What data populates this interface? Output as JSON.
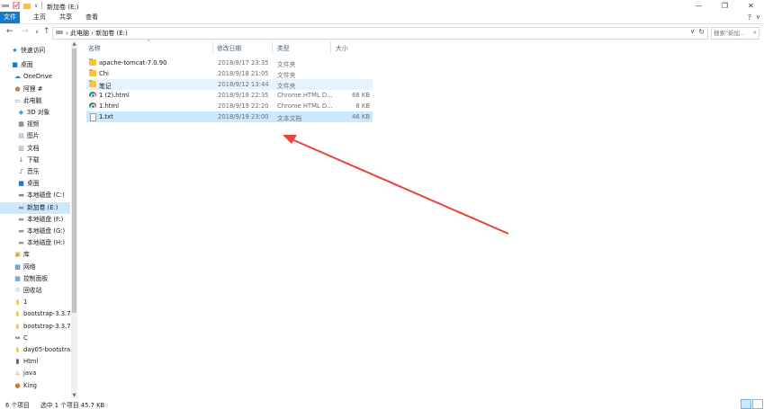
{
  "window": {
    "title": "新加卷 (E:)",
    "controls": [
      "—",
      "❐",
      "✕"
    ]
  },
  "ribbon": {
    "tabs": [
      "文件",
      "主页",
      "共享",
      "查看"
    ],
    "help": "?",
    "expand": "∨"
  },
  "nav": {
    "back": "←",
    "forward": "→",
    "recent": "∨",
    "up": "↑"
  },
  "address": {
    "crumbs": "›  此电脑  ›  新加卷 (E:)",
    "dropdown": "∨",
    "refresh": "↻"
  },
  "search": {
    "placeholder": "搜索\"新加...",
    "icon": "⌕"
  },
  "sidebar": {
    "items": [
      {
        "label": "快速访问",
        "icon": "★",
        "color": "#2a7ad5"
      },
      {
        "label": "桌面",
        "icon": "■",
        "color": "#1979ca"
      },
      {
        "label": "OneDrive",
        "icon": "☁",
        "color": "#2a7ad5"
      },
      {
        "label": "阿狸 #",
        "icon": "●",
        "color": "#d08030"
      },
      {
        "label": "此电脑",
        "icon": "▭",
        "color": "#3a7dc4"
      },
      {
        "label": "3D 对象",
        "icon": "◆",
        "color": "#3d9fd8"
      },
      {
        "label": "视频",
        "icon": "▦",
        "color": "#555555"
      },
      {
        "label": "图片",
        "icon": "▤",
        "color": "#6a90b8"
      },
      {
        "label": "文档",
        "icon": "▥",
        "color": "#7a8899"
      },
      {
        "label": "下载",
        "icon": "↓",
        "color": "#2a7ad5"
      },
      {
        "label": "音乐",
        "icon": "♪",
        "color": "#2a7ad5"
      },
      {
        "label": "桌面",
        "icon": "■",
        "color": "#1979ca"
      },
      {
        "label": "本地磁盘 (C:)",
        "icon": "▬",
        "color": "#6a8aa8"
      },
      {
        "label": "新加卷 (E:)",
        "icon": "▬",
        "color": "#8a9aa8"
      },
      {
        "label": "本地磁盘 (F:)",
        "icon": "▬",
        "color": "#8a9aa8"
      },
      {
        "label": "本地磁盘 (G:)",
        "icon": "▬",
        "color": "#8a9aa8"
      },
      {
        "label": "本地磁盘 (H:)",
        "icon": "▬",
        "color": "#8a9aa8"
      },
      {
        "label": "库",
        "icon": "▣",
        "color": "#d8a030"
      },
      {
        "label": "网络",
        "icon": "▩",
        "color": "#2a7ad5"
      },
      {
        "label": "控制面板",
        "icon": "▦",
        "color": "#3a7dc4"
      },
      {
        "label": "回收站",
        "icon": "♲",
        "color": "#5a8ab0"
      },
      {
        "label": "1",
        "icon": "▮",
        "color": "#f1c44b"
      },
      {
        "label": "bootstrap-3.3.7",
        "icon": "▮",
        "color": "#f1c44b"
      },
      {
        "label": "bootstrap-3.3.7",
        "icon": "▮",
        "color": "#f1c44b"
      },
      {
        "label": "C",
        "icon": "⇔",
        "color": "#444444"
      },
      {
        "label": "day05-bootstrap",
        "icon": "▮",
        "color": "#f1c44b"
      },
      {
        "label": "Html",
        "icon": "▮",
        "color": "#555555"
      },
      {
        "label": "java",
        "icon": "♨",
        "color": "#c05030"
      },
      {
        "label": "King",
        "icon": "●",
        "color": "#e07020"
      }
    ],
    "selected_index": 13
  },
  "columns": [
    "名称",
    "修改日期",
    "类型",
    "大小"
  ],
  "files": [
    {
      "name": "apache-tomcat-7.0.90",
      "date": "2018/8/17 23:35",
      "type": "文件夹",
      "size": "",
      "icon": "folder"
    },
    {
      "name": "Chi",
      "date": "2018/9/18 21:05",
      "type": "文件夹",
      "size": "",
      "icon": "folder"
    },
    {
      "name": "笔记",
      "date": "2018/9/12 13:44",
      "type": "文件夹",
      "size": "",
      "icon": "folder",
      "state": "hover"
    },
    {
      "name": "1 (2).html",
      "date": "2018/9/19 22:35",
      "type": "Chrome HTML D...",
      "size": "68 KB",
      "icon": "chrome"
    },
    {
      "name": "1.html",
      "date": "2018/9/19 22:20",
      "type": "Chrome HTML D...",
      "size": "8 KB",
      "icon": "chrome"
    },
    {
      "name": "1.txt",
      "date": "2018/9/19 23:00",
      "type": "文本文档",
      "size": "46 KB",
      "icon": "txt",
      "state": "selected"
    }
  ],
  "status": {
    "count": "6 个项目",
    "selection": "选中 1 个项目  45.7 KB"
  },
  "colors": {
    "accent": "#1979ca",
    "selection": "#cce8ff",
    "arrow": "#e8433a"
  }
}
